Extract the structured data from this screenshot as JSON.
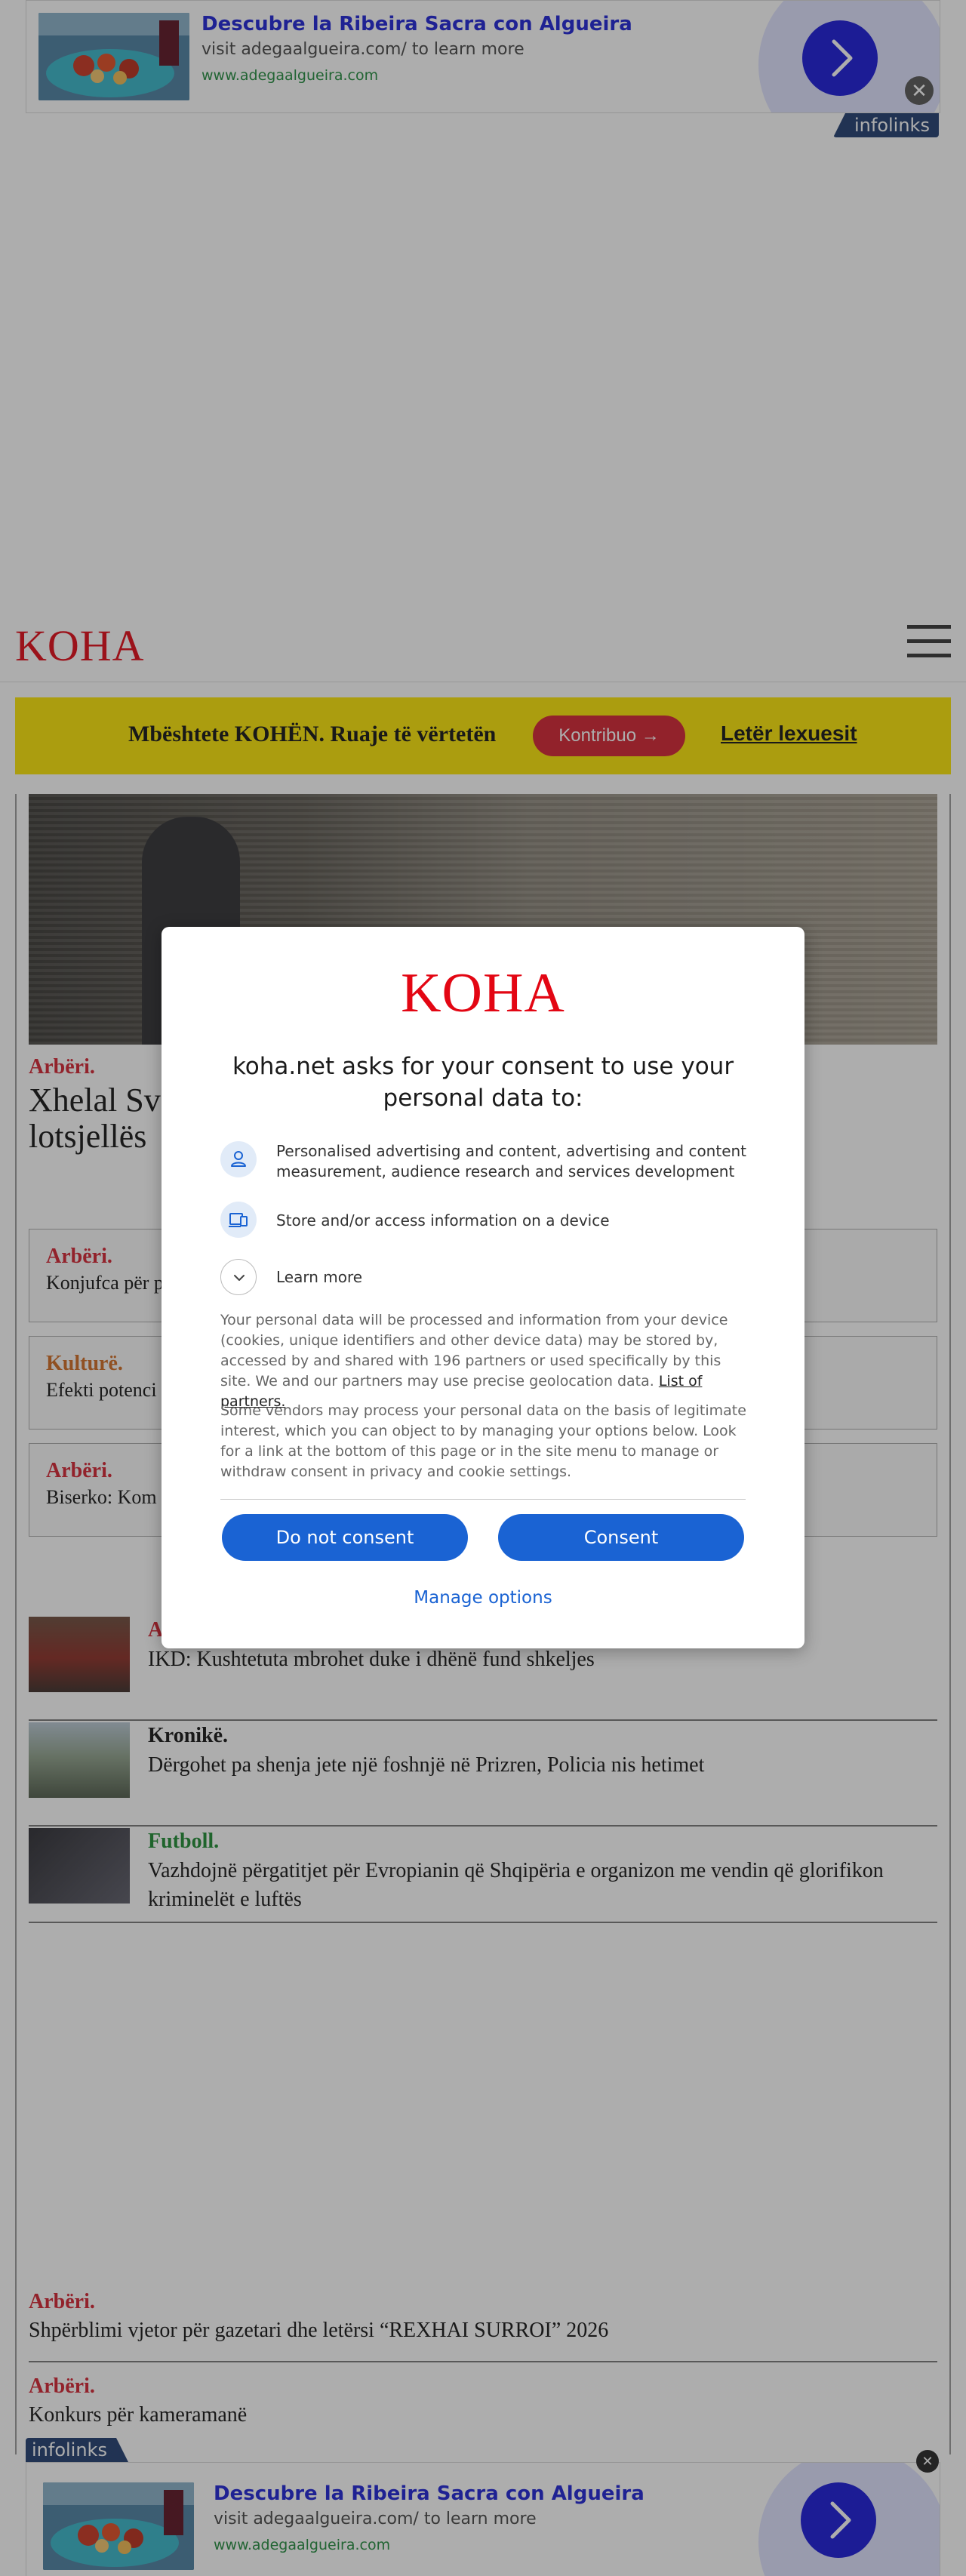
{
  "ad": {
    "title": "Descubre la Ribeira Sacra con Algueira",
    "subtitle": "visit adegaalgueira.com/ to learn more",
    "url": "www.adegaalgueira.com",
    "close": "✕",
    "network": "infolinks"
  },
  "header": {
    "logo": "KOHA",
    "menu_icon": "hamburger-menu-icon"
  },
  "support": {
    "text": "Mbështete KOHËN. Ruaje të vërtetën",
    "button": "Kontribuo →",
    "link": "Letër lexuesit"
  },
  "hero": {
    "category": "Arbëri.",
    "title": "Xhelal Sv lotsjellës"
  },
  "boxes": [
    {
      "category": "Arbëri.",
      "title": "Konjufca për p"
    },
    {
      "category": "Kulturë.",
      "title": "Efekti potenci"
    },
    {
      "category": "Arbëri.",
      "title": "Biserko: Kom"
    }
  ],
  "rows": [
    {
      "category": "A",
      "title": "IKD: Kushtetuta mbrohet duke i dhënë fund shkeljes"
    },
    {
      "category": "Kronikë.",
      "title": "Dërgohet pa shenja jete një foshnjë në Prizren, Policia nis hetimet"
    },
    {
      "category": "Futboll.",
      "title": "Vazhdojnë përgatitjet për Evropianin që Shqipëria e organizon me vendin që glorifikon kriminelët e luftës"
    }
  ],
  "simple": [
    {
      "category": "Arbëri.",
      "title": "Shpërblimi vjetor për gazetari dhe letërsi “REXHAI SURROI” 2026"
    },
    {
      "category": "Arbëri.",
      "title": "Konkurs për kameramanë"
    }
  ],
  "consent": {
    "logo": "KOHA",
    "heading": "koha.net asks for your consent to use your personal data to:",
    "purposes": [
      {
        "icon": "person-icon",
        "label": "Personalised advertising and content, advertising and content measurement, audience research and services development"
      },
      {
        "icon": "devices-icon",
        "label": "Store and/or access information on a device"
      }
    ],
    "learn_more": "Learn more",
    "paragraph1": "Your personal data will be processed and information from your device (cookies, unique identifiers and other device data) may be stored by, accessed by and shared with 196 partners or used specifically by this site. We and our partners may use precise geolocation data.",
    "partners_link": "List of partners.",
    "paragraph2": "Some vendors may process your personal data on the basis of legitimate interest, which you can object to by managing your options below. Look for a link at the bottom of this page or in the site menu to manage or withdraw consent in privacy and cookie settings.",
    "do_not_consent": "Do not consent",
    "consent": "Consent",
    "manage": "Manage options"
  },
  "colors": {
    "brand_red": "#e30613",
    "consent_blue": "#1a63d3",
    "support_yellow": "#fce500",
    "ad_blue": "#1515d8"
  }
}
